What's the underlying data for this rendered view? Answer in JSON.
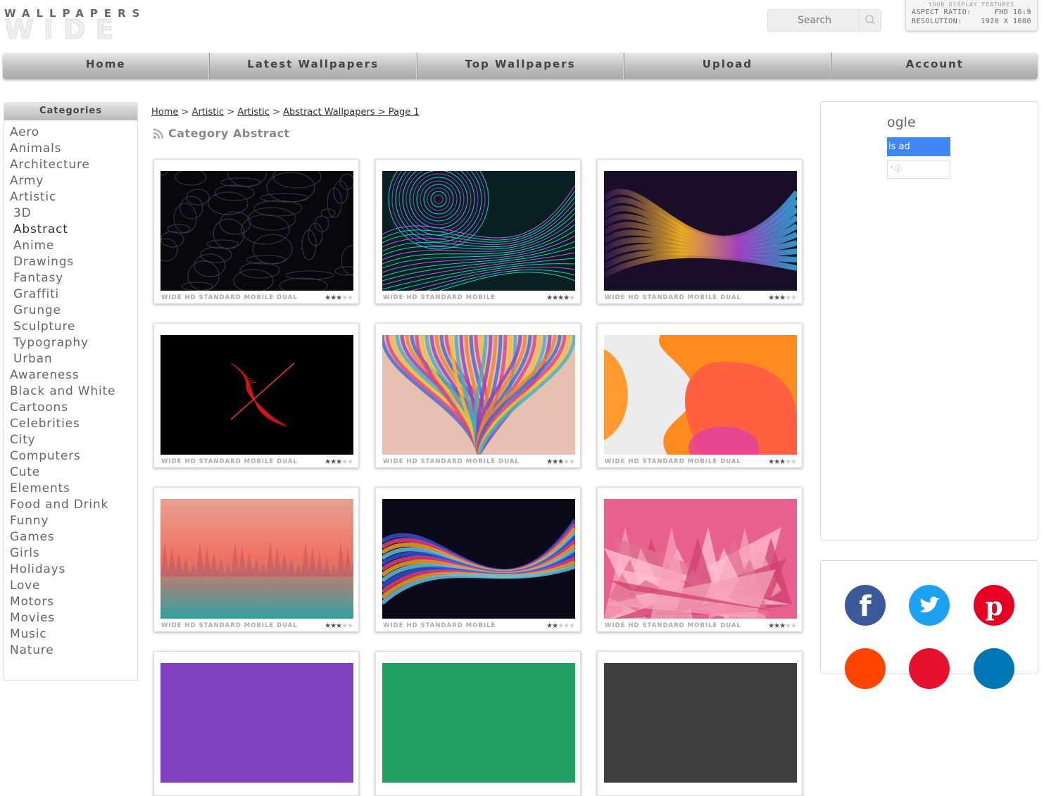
{
  "logo": {
    "top": "WALLPAPERS",
    "bottom": "WIDE"
  },
  "search": {
    "placeholder": "Search"
  },
  "display": {
    "title": "YOUR DISPLAY FEATURES",
    "aspect_label": "ASPECT RATIO:",
    "aspect_value": "FHD 16:9",
    "resolution_label": "RESOLUTION:",
    "resolution_value": "1920 X 1080"
  },
  "nav": [
    "Home",
    "Latest Wallpapers",
    "Top Wallpapers",
    "Upload",
    "Account"
  ],
  "sidebar": {
    "title": "Categories",
    "items": [
      {
        "label": "Aero",
        "sub": false
      },
      {
        "label": "Animals",
        "sub": false
      },
      {
        "label": "Architecture",
        "sub": false
      },
      {
        "label": "Army",
        "sub": false
      },
      {
        "label": "Artistic",
        "sub": false
      },
      {
        "label": "3D",
        "sub": true
      },
      {
        "label": "Abstract",
        "sub": true,
        "active": true
      },
      {
        "label": "Anime",
        "sub": true
      },
      {
        "label": "Drawings",
        "sub": true
      },
      {
        "label": "Fantasy",
        "sub": true
      },
      {
        "label": "Graffiti",
        "sub": true
      },
      {
        "label": "Grunge",
        "sub": true
      },
      {
        "label": "Sculpture",
        "sub": true
      },
      {
        "label": "Typography",
        "sub": true
      },
      {
        "label": "Urban",
        "sub": true
      },
      {
        "label": "Awareness",
        "sub": false
      },
      {
        "label": "Black and White",
        "sub": false
      },
      {
        "label": "Cartoons",
        "sub": false
      },
      {
        "label": "Celebrities",
        "sub": false
      },
      {
        "label": "City",
        "sub": false
      },
      {
        "label": "Computers",
        "sub": false
      },
      {
        "label": "Cute",
        "sub": false
      },
      {
        "label": "Elements",
        "sub": false
      },
      {
        "label": "Food and Drink",
        "sub": false
      },
      {
        "label": "Funny",
        "sub": false
      },
      {
        "label": "Games",
        "sub": false
      },
      {
        "label": "Girls",
        "sub": false
      },
      {
        "label": "Holidays",
        "sub": false
      },
      {
        "label": "Love",
        "sub": false
      },
      {
        "label": "Motors",
        "sub": false
      },
      {
        "label": "Movies",
        "sub": false
      },
      {
        "label": "Music",
        "sub": false
      },
      {
        "label": "Nature",
        "sub": false
      }
    ]
  },
  "breadcrumb": {
    "home": "Home",
    "sep": " > ",
    "artistic1": "Artistic",
    "artistic2": "Artistic",
    "current": "Abstract Wallpapers > Page 1"
  },
  "category_title": "Category Abstract",
  "wallpapers": [
    {
      "tags": "WIDE HD STANDARD MOBILE DUAL",
      "rating": 2.5,
      "theme": "dark-topo"
    },
    {
      "tags": "WIDE HD STANDARD MOBILE",
      "rating": 3.5,
      "theme": "neon-lines"
    },
    {
      "tags": "WIDE HD STANDARD MOBILE DUAL",
      "rating": 3,
      "theme": "fluid-waves"
    },
    {
      "tags": "WIDE HD STANDARD MOBILE DUAL",
      "rating": 2.5,
      "theme": "red-smoke"
    },
    {
      "tags": "WIDE HD STANDARD MOBILE DUAL",
      "rating": 2.5,
      "theme": "color-burst"
    },
    {
      "tags": "WIDE HD STANDARD MOBILE DUAL",
      "rating": 3,
      "theme": "orange-shapes"
    },
    {
      "tags": "WIDE HD STANDARD MOBILE DUAL",
      "rating": 2.5,
      "theme": "pastel-forest"
    },
    {
      "tags": "WIDE HD STANDARD MOBILE",
      "rating": 2,
      "theme": "dark-swirl"
    },
    {
      "tags": "WIDE HD STANDARD MOBILE DUAL",
      "rating": 2.5,
      "theme": "pink-lowpoly"
    }
  ],
  "ad": {
    "logo_text": "ogle",
    "button_text": "is ad",
    "info_text": "' ⓘ"
  },
  "social": [
    "facebook-icon",
    "twitter-icon",
    "pinterest-icon",
    "reddit-icon",
    "email-icon",
    "linkedin-icon"
  ]
}
